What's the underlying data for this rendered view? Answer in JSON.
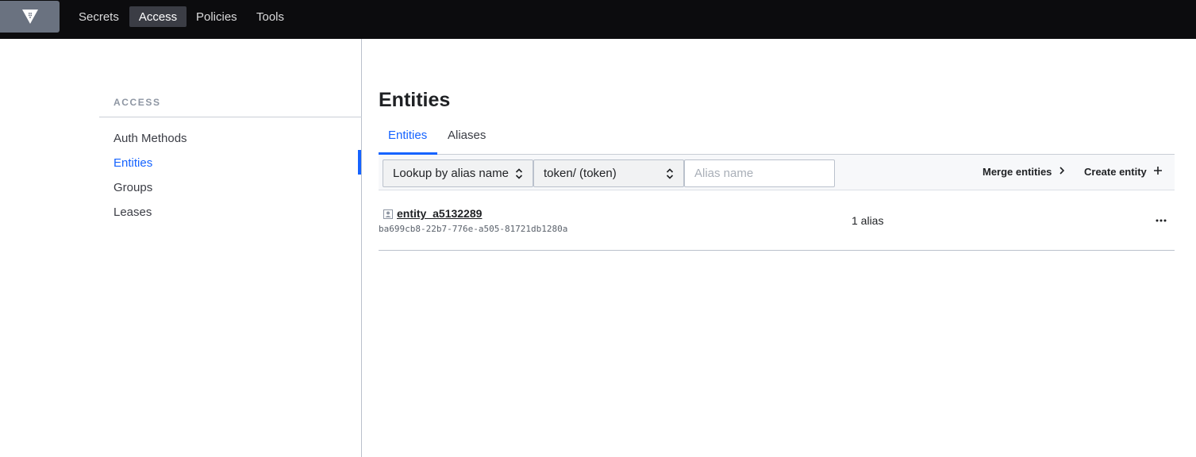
{
  "nav": {
    "logo_icon": "vault-logo-icon",
    "items": [
      {
        "label": "Secrets"
      },
      {
        "label": "Access",
        "active": true
      },
      {
        "label": "Policies"
      },
      {
        "label": "Tools"
      }
    ]
  },
  "sidebar": {
    "heading": "ACCESS",
    "items": [
      {
        "label": "Auth Methods"
      },
      {
        "label": "Entities",
        "active": true
      },
      {
        "label": "Groups"
      },
      {
        "label": "Leases"
      }
    ]
  },
  "main": {
    "title": "Entities",
    "tabs": [
      {
        "label": "Entities",
        "active": true
      },
      {
        "label": "Aliases"
      }
    ],
    "toolbar": {
      "lookup_select_value": "Lookup by alias name",
      "backend_select_value": "token/ (token)",
      "alias_placeholder": "Alias name",
      "merge_label": "Merge entities",
      "create_label": "Create entity"
    },
    "entities": [
      {
        "icon": "user-square-icon",
        "name": "entity_a5132289",
        "id": "ba699cb8-22b7-776e-a505-81721db1280a",
        "alias_count": "1 alias"
      }
    ]
  },
  "colors": {
    "accent": "#1563ff",
    "topbar": "#0c0c0e",
    "logo_bg": "#6a7280"
  }
}
